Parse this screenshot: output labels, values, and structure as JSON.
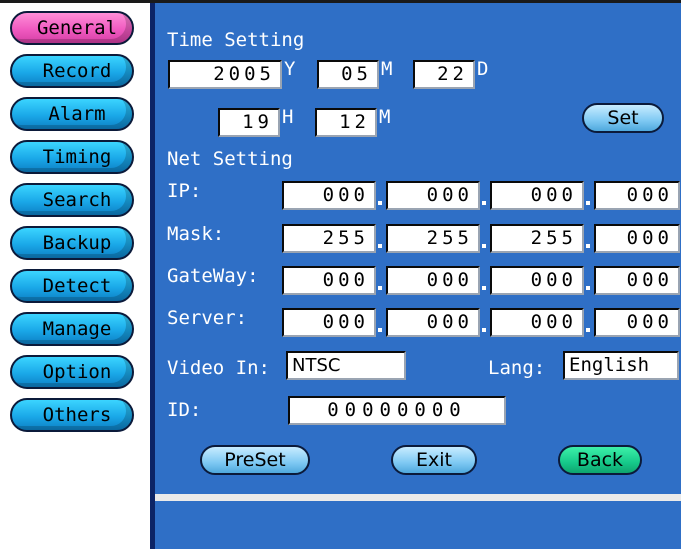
{
  "nav": {
    "items": [
      {
        "label": "General",
        "active": true
      },
      {
        "label": "Record",
        "active": false
      },
      {
        "label": "Alarm",
        "active": false
      },
      {
        "label": "Timing",
        "active": false
      },
      {
        "label": "Search",
        "active": false
      },
      {
        "label": "Backup",
        "active": false
      },
      {
        "label": "Detect",
        "active": false
      },
      {
        "label": "Manage",
        "active": false
      },
      {
        "label": "Option",
        "active": false
      },
      {
        "label": "Others",
        "active": false
      }
    ]
  },
  "time": {
    "title": "Time Setting",
    "year": "2005",
    "year_unit": "Y",
    "month": "05",
    "month_unit": "M",
    "day": "22",
    "day_unit": "D",
    "hour": "19",
    "hour_unit": "H",
    "minute": "12",
    "minute_unit": "M",
    "set_label": "Set"
  },
  "net": {
    "title": "Net Setting",
    "ip_label": "IP:",
    "ip": [
      "000",
      "000",
      "000",
      "000"
    ],
    "mask_label": "Mask:",
    "mask": [
      "255",
      "255",
      "255",
      "000"
    ],
    "gateway_label": "GateWay:",
    "gateway": [
      "000",
      "000",
      "000",
      "000"
    ],
    "server_label": "Server:",
    "server": [
      "000",
      "000",
      "000",
      "000"
    ]
  },
  "video": {
    "label": "Video In:",
    "value": "NTSC"
  },
  "lang": {
    "label": "Lang:",
    "value": "English"
  },
  "id": {
    "label": "ID:",
    "value": "00000000"
  },
  "buttons": {
    "preset": "PreSet",
    "exit": "Exit",
    "back": "Back"
  },
  "colors": {
    "panel": "#2f6fc6",
    "nav_button": "#1aa8e8",
    "nav_active": "#f05ac0",
    "back_button": "#16c98a"
  }
}
